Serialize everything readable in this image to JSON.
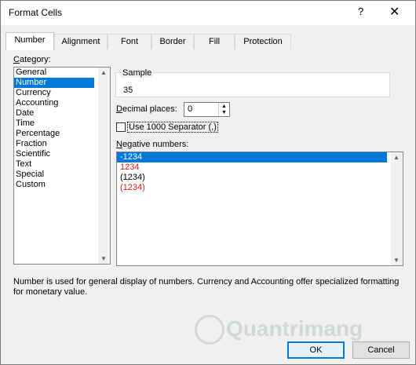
{
  "window": {
    "title": "Format Cells",
    "help": "?",
    "close": "✕"
  },
  "tabs": [
    {
      "label": "Number",
      "active": true
    },
    {
      "label": "Alignment"
    },
    {
      "label": "Font"
    },
    {
      "label": "Border"
    },
    {
      "label": "Fill"
    },
    {
      "label": "Protection"
    }
  ],
  "category": {
    "label": "Category:",
    "items": [
      "General",
      "Number",
      "Currency",
      "Accounting",
      "Date",
      "Time",
      "Percentage",
      "Fraction",
      "Scientific",
      "Text",
      "Special",
      "Custom"
    ],
    "selected": "Number"
  },
  "sample": {
    "label": "Sample",
    "value": "35"
  },
  "decimal": {
    "label": "Decimal places:",
    "value": "0"
  },
  "separator": {
    "label": "Use 1000 Separator (,)",
    "checked": false
  },
  "negative": {
    "label": "Negative numbers:",
    "items": [
      "-1234",
      "1234",
      "(1234)",
      "(1234)"
    ],
    "selected": "-1234"
  },
  "description": "Number is used for general display of numbers.  Currency and Accounting offer specialized formatting for monetary value.",
  "buttons": {
    "ok": "OK",
    "cancel": "Cancel"
  },
  "watermark": "Quantrimang",
  "colors": {
    "selection": "#0078d7",
    "negative_red": "#e01818"
  }
}
